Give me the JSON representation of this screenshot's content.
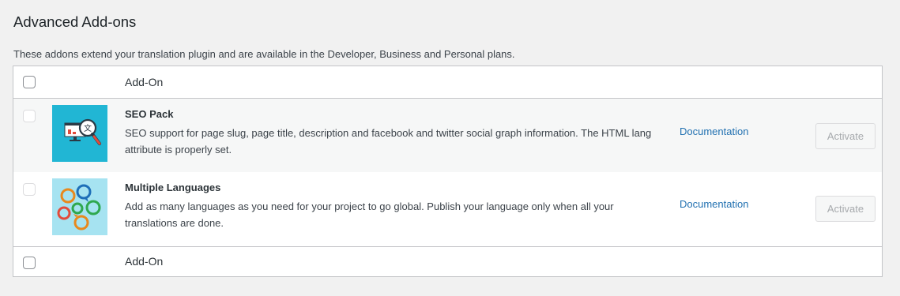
{
  "page": {
    "title": "Advanced Add-ons",
    "description": "These addons extend your translation plugin and are available in the Developer, Business and Personal plans."
  },
  "table": {
    "header_label": "Add-On",
    "footer_label": "Add-On",
    "rows": [
      {
        "name": "SEO Pack",
        "description": "SEO support for page slug, page title, description and facebook and twitter social graph information. The HTML lang attribute is properly set.",
        "link": "Documentation",
        "action": "Activate",
        "icon": "seo-pack-icon"
      },
      {
        "name": "Multiple Languages",
        "description": "Add as many languages as you need for your project to go global. Publish your language only when all your translations are done.",
        "link": "Documentation",
        "action": "Activate",
        "icon": "multiple-languages-icon"
      }
    ]
  },
  "colors": {
    "link": "#2271b1",
    "seo_bg": "#21b6d4",
    "lang_bg": "#a6e3f1"
  }
}
